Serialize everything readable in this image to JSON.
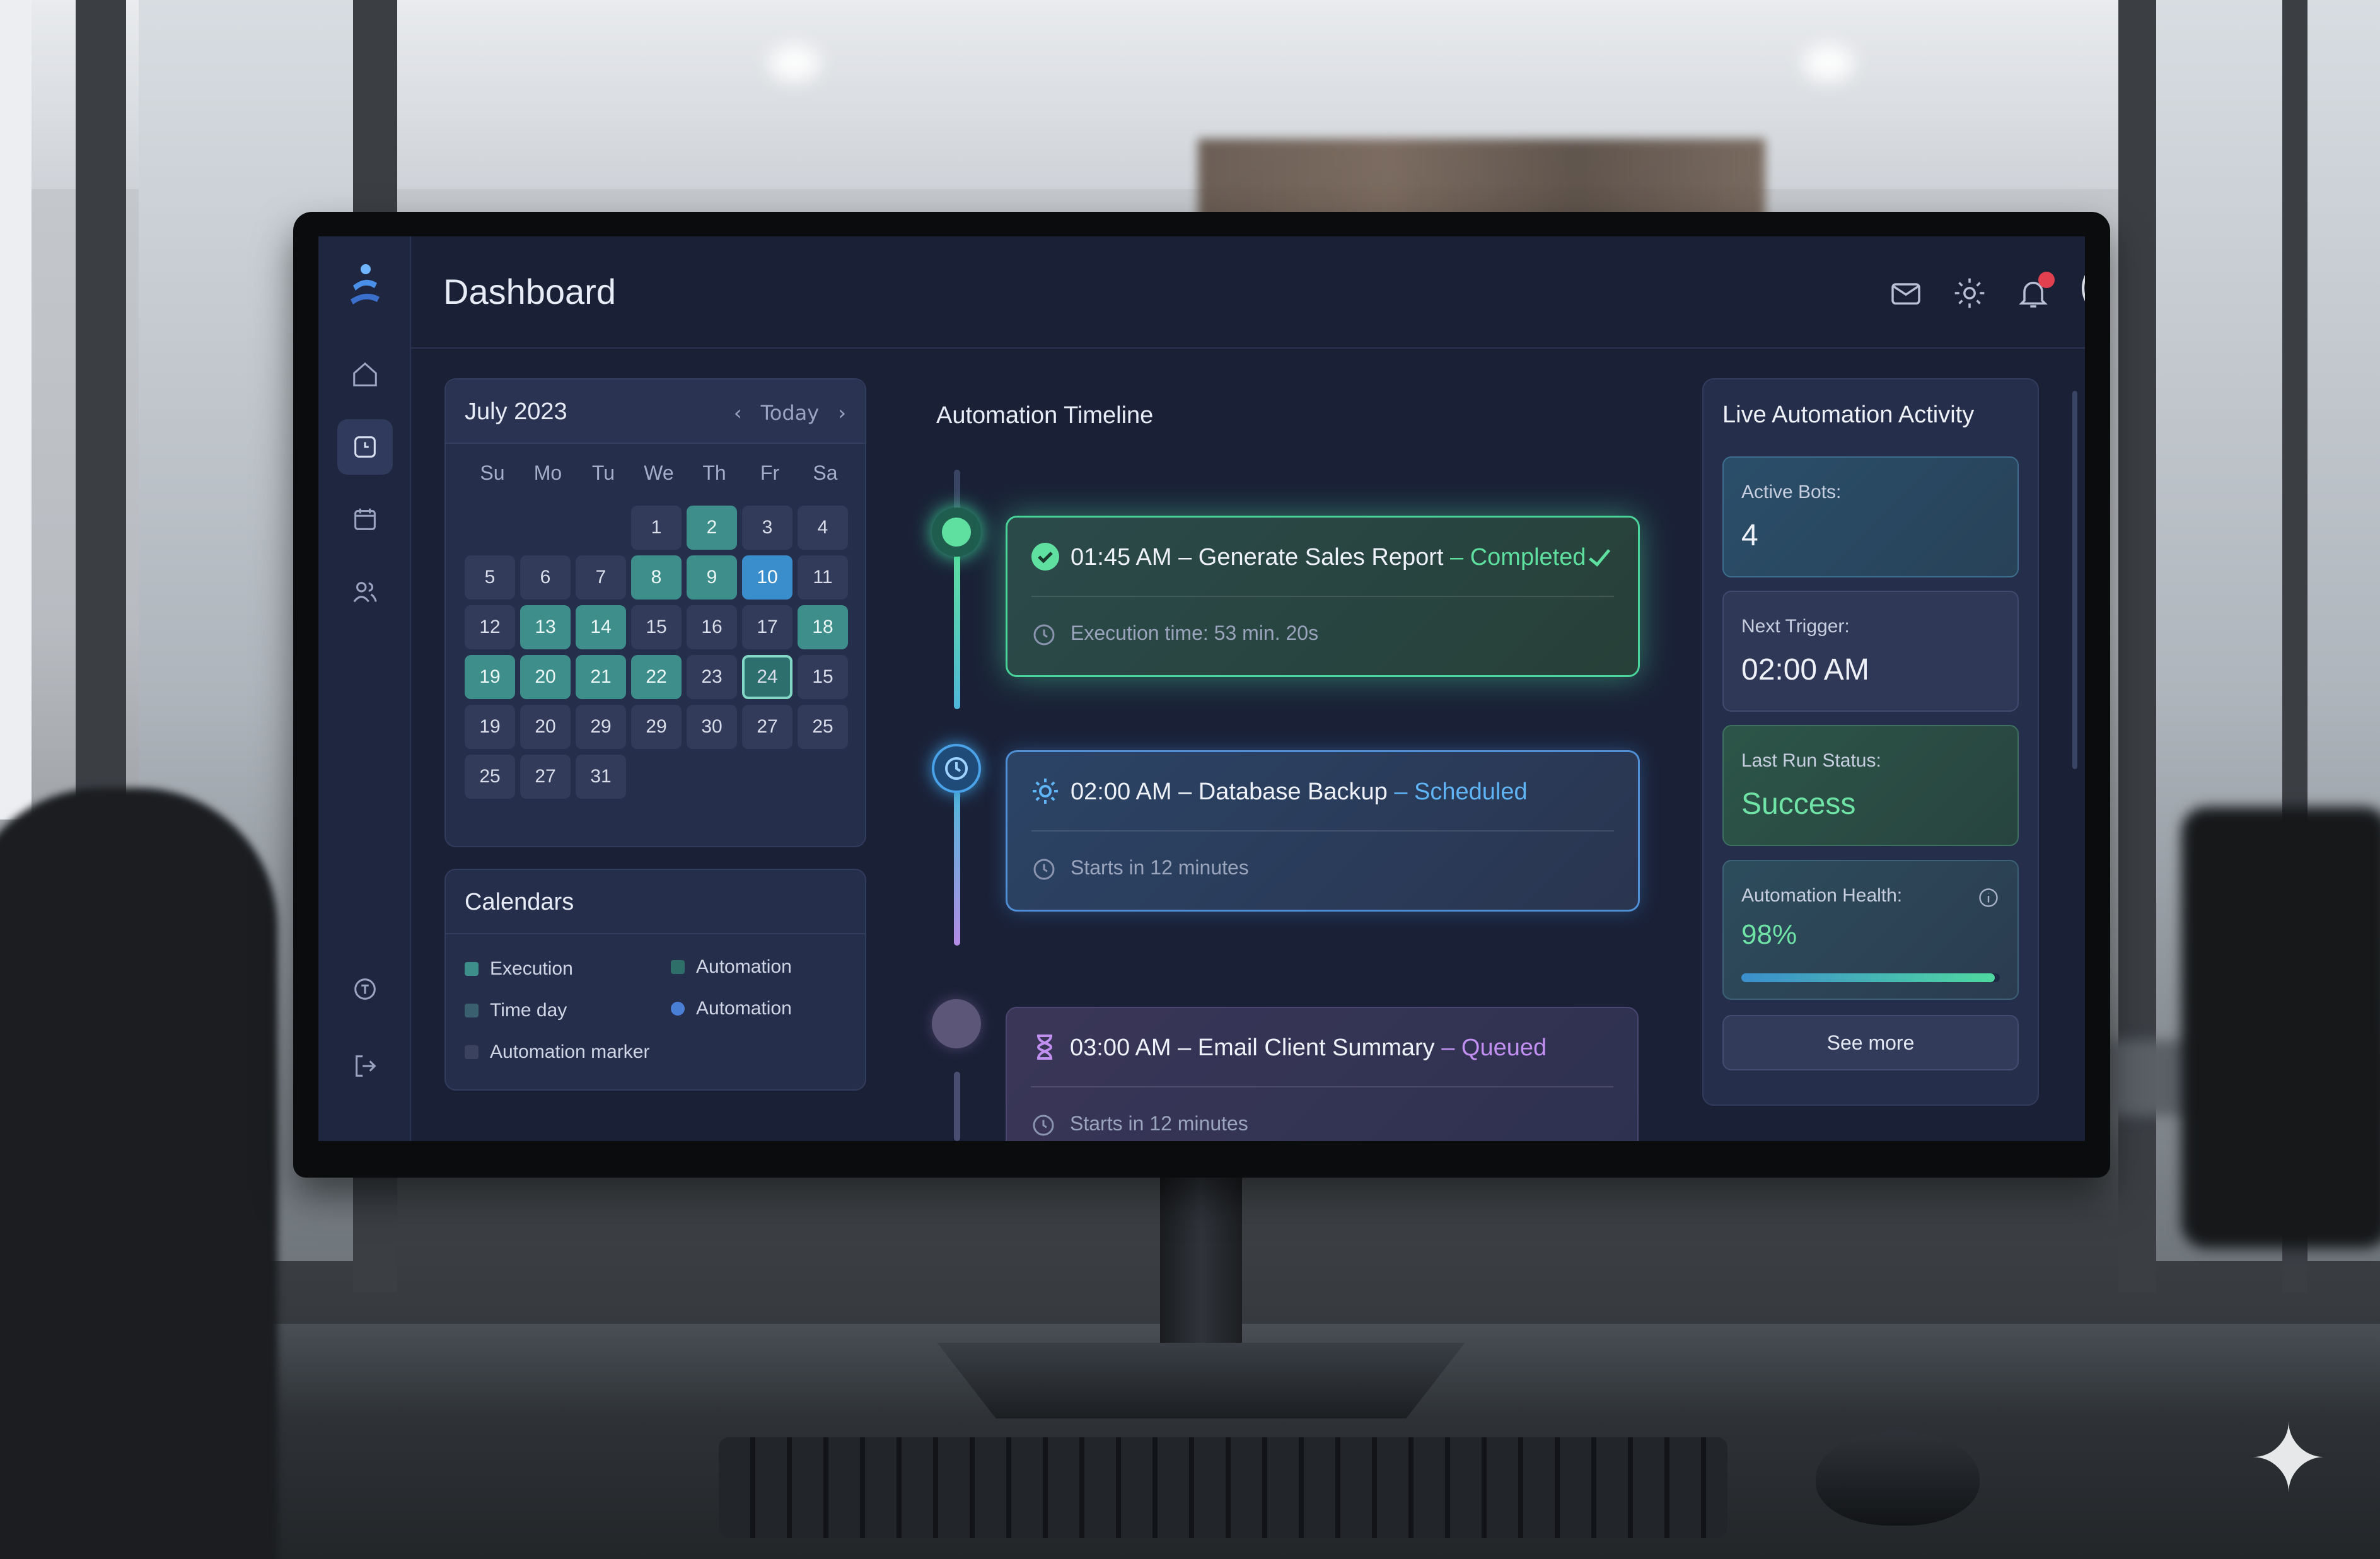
{
  "header": {
    "title": "Dashboard"
  },
  "sidebar": {
    "items": [
      {
        "icon": "home-icon"
      },
      {
        "icon": "clock-icon",
        "active": true
      },
      {
        "icon": "calendar-icon"
      },
      {
        "icon": "users-icon"
      }
    ],
    "bottom": [
      {
        "icon": "help-icon"
      },
      {
        "icon": "logout-icon"
      }
    ]
  },
  "header_icons": [
    "mail-icon",
    "gear-icon",
    "bell-icon",
    "avatar"
  ],
  "calendar": {
    "month": "July 2023",
    "today_label": "Today",
    "prev_icon": "‹",
    "next_icon": "›",
    "weekdays": [
      "Su",
      "Mo",
      "Tu",
      "We",
      "Th",
      "Fr",
      "Sa"
    ],
    "days": [
      {
        "t": "",
        "s": "empty"
      },
      {
        "t": "",
        "s": "empty"
      },
      {
        "t": "",
        "s": "empty"
      },
      {
        "t": "1",
        "s": ""
      },
      {
        "t": "2",
        "s": "teal"
      },
      {
        "t": "3",
        "s": ""
      },
      {
        "t": "4",
        "s": ""
      },
      {
        "t": "5",
        "s": ""
      },
      {
        "t": "6",
        "s": ""
      },
      {
        "t": "7",
        "s": ""
      },
      {
        "t": "8",
        "s": "teal"
      },
      {
        "t": "9",
        "s": "teal"
      },
      {
        "t": "10",
        "s": "blue"
      },
      {
        "t": "11",
        "s": ""
      },
      {
        "t": "12",
        "s": ""
      },
      {
        "t": "13",
        "s": "teal"
      },
      {
        "t": "14",
        "s": "teal"
      },
      {
        "t": "15",
        "s": ""
      },
      {
        "t": "16",
        "s": ""
      },
      {
        "t": "17",
        "s": ""
      },
      {
        "t": "18",
        "s": "teal"
      },
      {
        "t": "19",
        "s": "teal"
      },
      {
        "t": "20",
        "s": "teal"
      },
      {
        "t": "21",
        "s": "teal"
      },
      {
        "t": "22",
        "s": "teal"
      },
      {
        "t": "23",
        "s": ""
      },
      {
        "t": "24",
        "s": "outline"
      },
      {
        "t": "15",
        "s": ""
      },
      {
        "t": "19",
        "s": ""
      },
      {
        "t": "20",
        "s": ""
      },
      {
        "t": "29",
        "s": ""
      },
      {
        "t": "29",
        "s": ""
      },
      {
        "t": "30",
        "s": ""
      },
      {
        "t": "27",
        "s": ""
      },
      {
        "t": "25",
        "s": ""
      },
      {
        "t": "25",
        "s": ""
      },
      {
        "t": "27",
        "s": ""
      },
      {
        "t": "31",
        "s": ""
      }
    ]
  },
  "calendars": {
    "title": "Calendars",
    "legend": [
      {
        "label": "Execution",
        "color": "#3e8f8b"
      },
      {
        "label": "Automation",
        "color": "#2f6f6a"
      },
      {
        "label": "Time day",
        "color": "#3a5f6e"
      },
      {
        "label": "Automation",
        "color": "#4a7fd6"
      },
      {
        "label": "Automation marker",
        "color": "#3a4260"
      }
    ]
  },
  "timeline": {
    "title": "Automation Timeline",
    "items": [
      {
        "time_task": "01:45 AM – Generate Sales Report",
        "status": " – Completed",
        "status_color": "#5fe0a0",
        "sub": "Execution time: 53 min. 20s"
      },
      {
        "time_task": "02:00 AM – Database Backup",
        "status": " – Scheduled",
        "status_color": "#5fb4f5",
        "sub": "Starts in 12 minutes"
      },
      {
        "time_task": "03:00 AM – Email Client Summary",
        "status": " – Queued",
        "status_color": "#c08ff0",
        "sub": "Starts in 12 minutes"
      }
    ]
  },
  "live": {
    "title": "Live Automation Activity",
    "stats": [
      {
        "label": "Active Bots:",
        "value": "4"
      },
      {
        "label": "Next Trigger:",
        "value": "02:00 AM"
      },
      {
        "label": "Last Run Status:",
        "value": "Success"
      },
      {
        "label": "Automation Health:",
        "value": "98%",
        "progress": 0.98
      }
    ],
    "see_more": "See more"
  }
}
